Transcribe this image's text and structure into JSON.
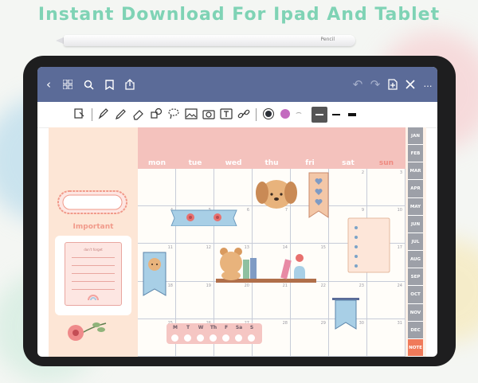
{
  "headline": "Instant Download For Ipad And Tablet",
  "pencil": {
    "brand": "Pencil"
  },
  "topbar": {
    "icons": [
      "back-chevron-icon",
      "grid-icon",
      "search-icon",
      "bookmark-icon",
      "share-icon",
      "undo-icon",
      "redo-icon",
      "add-page-icon",
      "close-icon",
      "more-icon"
    ]
  },
  "toolbar": {
    "selected_color": "#2b2f36",
    "secondary_color": "#c36bbf"
  },
  "calendar": {
    "days": [
      "mon",
      "tue",
      "wed",
      "thu",
      "fri",
      "sat",
      "sun"
    ],
    "day_colors": [
      "#ffffff",
      "#ffffff",
      "#ffffff",
      "#ffffff",
      "#ffffff",
      "#ffffff",
      "#ef8a80"
    ],
    "weeks": [
      [
        "",
        "",
        "",
        "",
        "",
        "2",
        "3"
      ],
      [
        "4",
        "5",
        "6",
        "7",
        "8",
        "9",
        "10"
      ],
      [
        "11",
        "12",
        "13",
        "14",
        "15",
        "16",
        "17"
      ],
      [
        "18",
        "19",
        "20",
        "21",
        "22",
        "23",
        "24"
      ],
      [
        "25",
        "26",
        "27",
        "28",
        "29",
        "30",
        "31"
      ]
    ]
  },
  "months": [
    "JAN",
    "FEB",
    "MAR",
    "APR",
    "MAY",
    "JUN",
    "JUL",
    "AUG",
    "SEP",
    "OCT",
    "NOV",
    "DEC",
    "NOTE"
  ],
  "active_month": "NOTE",
  "left_panel": {
    "important_label": "Important",
    "note_title": "don't forget"
  },
  "habit": {
    "labels": [
      "M",
      "T",
      "W",
      "Th",
      "F",
      "Sa",
      "S"
    ]
  },
  "colors": {
    "topbar": "#5b6b98",
    "accent_pink": "#f4c2bd",
    "headline": "#7fd3b5",
    "tab": "#9da0a8",
    "tab_active": "#f07a5a"
  }
}
